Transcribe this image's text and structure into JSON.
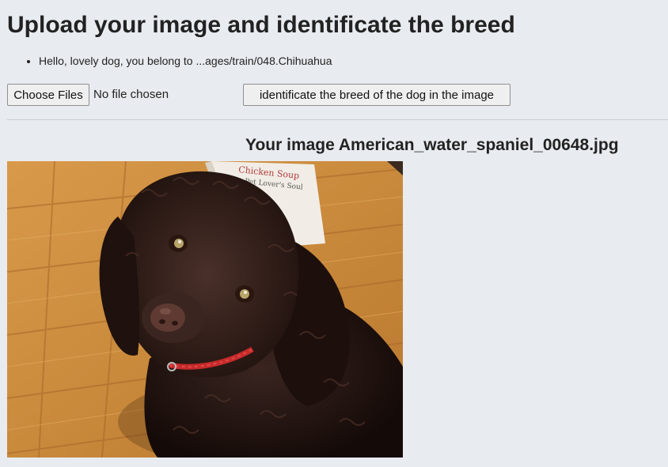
{
  "page": {
    "title": "Upload your image and identificate the breed",
    "result_message": "Hello, lovely dog, you belong to ...ages/train/048.Chihuahua"
  },
  "form": {
    "file_button_label": "Choose Files",
    "file_status": "No file chosen",
    "submit_label": "identificate the breed of the dog in the image"
  },
  "preview": {
    "caption": "Your image American_water_spaniel_00648.jpg",
    "book_text": "Chicken Soup for the Pet Lover's Soul"
  }
}
